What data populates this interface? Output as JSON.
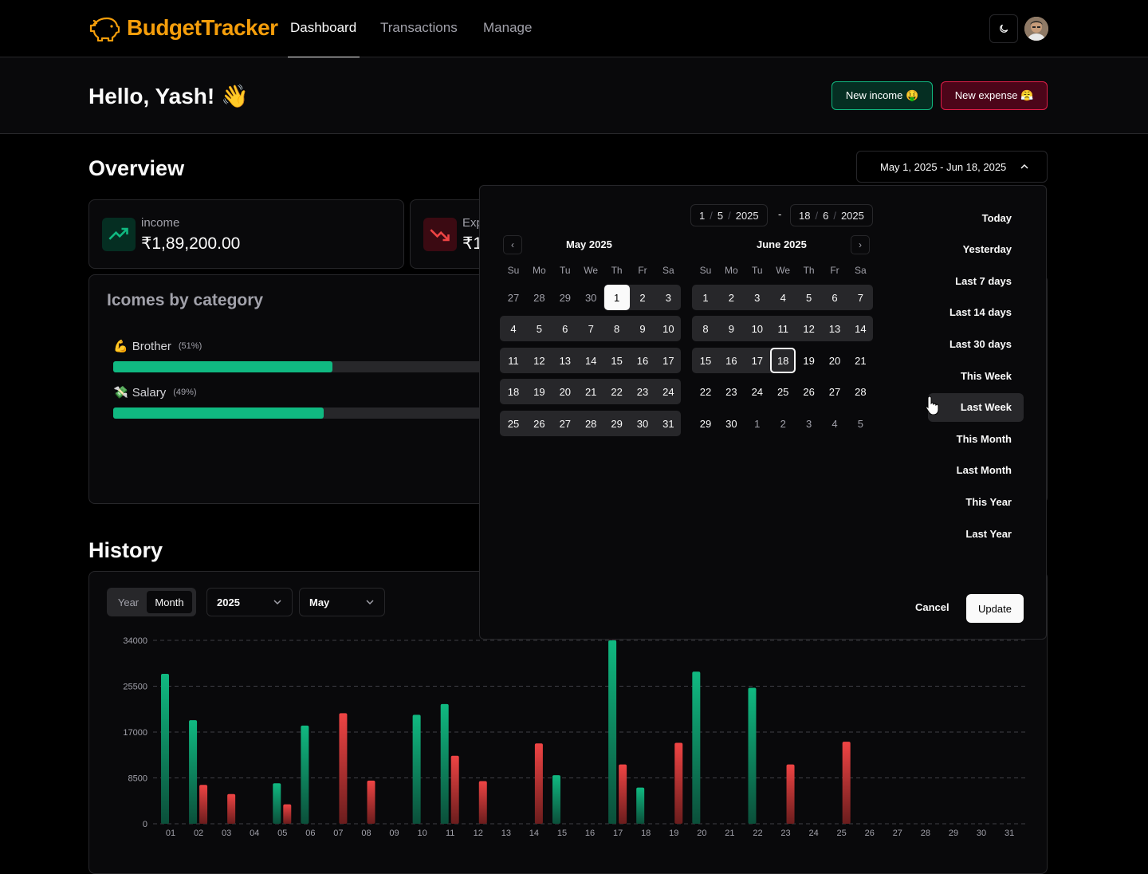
{
  "app": {
    "name": "BudgetTracker"
  },
  "nav": {
    "links": [
      "Dashboard",
      "Transactions",
      "Manage"
    ],
    "active": "Dashboard"
  },
  "greeting": {
    "title": "Hello, Yash! 👋"
  },
  "actions": {
    "new_income": "New income 🤑",
    "new_expense": "New expense 😤"
  },
  "overview": {
    "title": "Overview",
    "date_range": "May 1, 2025 - Jun 18, 2025"
  },
  "stats": {
    "income": {
      "label": "income",
      "value": "₹1,89,200.00"
    },
    "expense": {
      "label": "Exp",
      "value": "₹1"
    }
  },
  "income_categories": {
    "title": "Icomes by category",
    "items": [
      {
        "icon": "💪",
        "name": "Brother",
        "pct_label": "(51%)",
        "pct": 51
      },
      {
        "icon": "💸",
        "name": "Salary",
        "pct_label": "(49%)",
        "pct": 49
      }
    ]
  },
  "history": {
    "title": "History",
    "toggle": [
      "Year",
      "Month"
    ],
    "toggle_active": "Month",
    "year": "2025",
    "month": "May"
  },
  "date_picker": {
    "from": {
      "d": "1",
      "m": "5",
      "y": "2025"
    },
    "to": {
      "d": "18",
      "m": "6",
      "y": "2025"
    },
    "separator": "-",
    "months": [
      {
        "title": "May 2025",
        "lead": [
          "27",
          "28",
          "29",
          "30"
        ],
        "days": 31,
        "trail": []
      },
      {
        "title": "June 2025",
        "lead": [],
        "days": 30,
        "trail": [
          "1",
          "2",
          "3",
          "4",
          "5"
        ]
      }
    ],
    "weekdays": [
      "Su",
      "Mo",
      "Tu",
      "We",
      "Th",
      "Fr",
      "Sa"
    ],
    "presets": [
      "Today",
      "Yesterday",
      "Last 7 days",
      "Last 14 days",
      "Last 30 days",
      "This Week",
      "Last Week",
      "This Month",
      "Last Month",
      "This Year",
      "Last Year"
    ],
    "hovered_preset": "Last Week",
    "cancel": "Cancel",
    "update": "Update"
  },
  "chart_data": {
    "type": "bar",
    "title": "",
    "xlabel": "",
    "ylabel": "",
    "ylim": [
      0,
      34000
    ],
    "yticks": [
      0,
      8500,
      17000,
      25500,
      34000
    ],
    "grid": true,
    "categories": [
      "01",
      "02",
      "03",
      "04",
      "05",
      "06",
      "07",
      "08",
      "09",
      "10",
      "11",
      "12",
      "13",
      "14",
      "15",
      "16",
      "17",
      "18",
      "19",
      "20",
      "21",
      "22",
      "23",
      "24",
      "25",
      "26",
      "27",
      "28",
      "29",
      "30",
      "31"
    ],
    "series": [
      {
        "color": "#10b981",
        "values": [
          27800,
          19200,
          0,
          0,
          7500,
          18200,
          0,
          0,
          0,
          20200,
          22200,
          0,
          0,
          0,
          9000,
          0,
          34000,
          6700,
          0,
          28200,
          0,
          25200,
          0,
          0,
          0,
          0,
          0,
          0,
          0,
          0,
          0
        ]
      },
      {
        "color": "#ef4444",
        "values": [
          0,
          7200,
          5500,
          0,
          3600,
          0,
          20500,
          8000,
          0,
          0,
          12600,
          7900,
          0,
          14900,
          0,
          0,
          11000,
          0,
          15000,
          0,
          0,
          0,
          11000,
          0,
          15200,
          0,
          0,
          0,
          0,
          0,
          0
        ]
      }
    ]
  }
}
